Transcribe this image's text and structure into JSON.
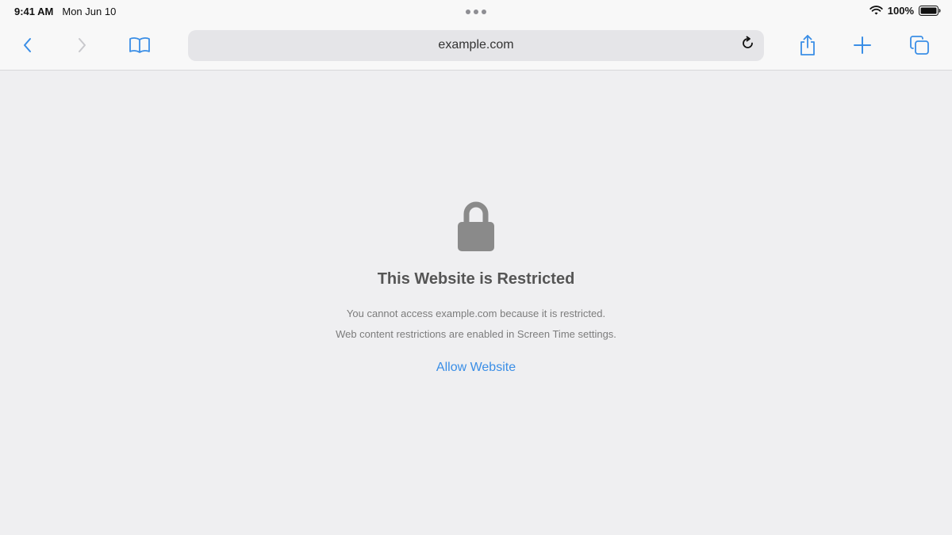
{
  "status_bar": {
    "time": "9:41 AM",
    "date": "Mon Jun 10",
    "battery_percent": "100%"
  },
  "address_bar": {
    "url": "example.com"
  },
  "restriction_page": {
    "title": "This Website is Restricted",
    "message_line_1": "You cannot access example.com because it is restricted.",
    "message_line_2": "Web content restrictions are enabled in Screen Time settings.",
    "allow_label": "Allow Website"
  },
  "colors": {
    "accent": "#3a8ee6",
    "background": "#efeff1",
    "title": "#555555",
    "body_text": "#7c7c7c"
  },
  "icons": {
    "back": "chevron-left-icon",
    "forward": "chevron-right-icon",
    "bookmarks": "book-icon",
    "reload": "reload-icon",
    "share": "share-icon",
    "new_tab": "plus-icon",
    "tabs": "tabs-icon",
    "lock": "lock-icon",
    "wifi": "wifi-icon",
    "battery": "battery-icon"
  }
}
